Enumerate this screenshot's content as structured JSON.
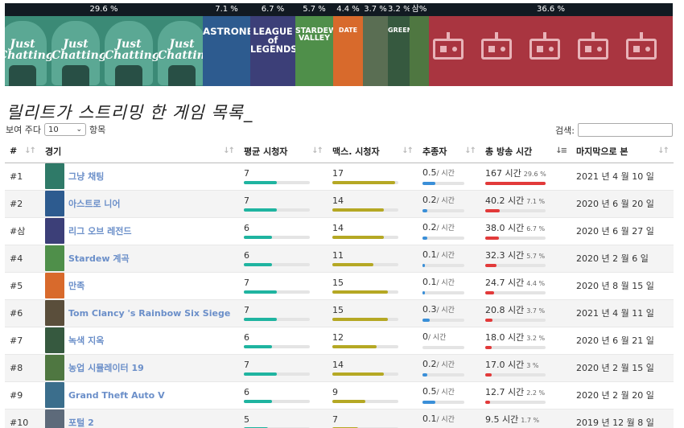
{
  "strip": [
    {
      "pct": "29.6 %",
      "width": 29.6,
      "kind": "jc",
      "name": "Just Chatting"
    },
    {
      "pct": "7.1 %",
      "width": 7.1,
      "kind": "astroneer",
      "name": "ASTRONEER",
      "color": "#2d5b8f"
    },
    {
      "pct": "6.7 %",
      "width": 6.7,
      "kind": "league",
      "name": "LEAGUE of LEGENDS",
      "color": "#3c3f78"
    },
    {
      "pct": "5.7 %",
      "width": 5.7,
      "kind": "stardew",
      "name": "STARDEW VALLEY",
      "color": "#4f8f4a"
    },
    {
      "pct": "4.4 %",
      "width": 4.4,
      "kind": "update",
      "name": "DATE",
      "color": "#d86a2c"
    },
    {
      "pct": "3.7 %",
      "width": 3.7,
      "kind": "r6",
      "name": "",
      "color": "#5a6e53"
    },
    {
      "pct": "3.2 %",
      "width": 3.2,
      "kind": "green",
      "name": "GREEN",
      "color": "#36593f"
    },
    {
      "pct": "삼%",
      "width": 2.9,
      "kind": "farm",
      "name": "",
      "color": "#4f7741"
    },
    {
      "pct": "36.6 %",
      "width": 36.6,
      "kind": "other",
      "name": ""
    }
  ],
  "title": "릴리트가 스트리밍 한 게임 목록_",
  "controls": {
    "show_label": "보여 주다",
    "page_size": "10",
    "entries_label": "항목",
    "search_label": "검색:",
    "search_value": ""
  },
  "columns": [
    "#",
    "경기",
    "평균 시청자",
    "맥스. 시청자",
    "추종자",
    "총 방송 시간",
    "마지막으로 본"
  ],
  "per_hour": "/ 시간",
  "hours_label": "시간",
  "rows": [
    {
      "rank": "#1",
      "game": "그냥 채팅",
      "thumb": "#2f7a68",
      "avg": "7",
      "avg_frac": 0.5,
      "max": "17",
      "max_frac": 0.95,
      "fol": "0.5",
      "fol_frac": 0.3,
      "hours": "167",
      "hours_pct": "29.6 %",
      "hours_frac": 1.0,
      "last": "2021 년 4 월 10 일"
    },
    {
      "rank": "#2",
      "game": "아스트로 니어",
      "thumb": "#2d5b8f",
      "avg": "7",
      "avg_frac": 0.5,
      "max": "14",
      "max_frac": 0.78,
      "fol": "0.2",
      "fol_frac": 0.12,
      "hours": "40.2",
      "hours_pct": "7.1 %",
      "hours_frac": 0.24,
      "last": "2020 년 6 월 20 일"
    },
    {
      "rank": "#삼",
      "game": "리그 오브 레전드",
      "thumb": "#3c3f78",
      "avg": "6",
      "avg_frac": 0.43,
      "max": "14",
      "max_frac": 0.78,
      "fol": "0.2",
      "fol_frac": 0.12,
      "hours": "38.0",
      "hours_pct": "6.7 %",
      "hours_frac": 0.23,
      "last": "2020 년 6 월 27 일"
    },
    {
      "rank": "#4",
      "game": "Stardew 계곡",
      "thumb": "#4f8f4a",
      "avg": "6",
      "avg_frac": 0.43,
      "max": "11",
      "max_frac": 0.62,
      "fol": "0.1",
      "fol_frac": 0.06,
      "hours": "32.3",
      "hours_pct": "5.7 %",
      "hours_frac": 0.19,
      "last": "2020 년 2 월 6 일"
    },
    {
      "rank": "#5",
      "game": "만족",
      "thumb": "#d86a2c",
      "avg": "7",
      "avg_frac": 0.5,
      "max": "15",
      "max_frac": 0.84,
      "fol": "0.1",
      "fol_frac": 0.06,
      "hours": "24.7",
      "hours_pct": "4.4 %",
      "hours_frac": 0.15,
      "last": "2020 년 8 월 15 일"
    },
    {
      "rank": "#6",
      "game": "Tom Clancy 's Rainbow Six Siege",
      "thumb": "#5a4e3b",
      "avg": "7",
      "avg_frac": 0.5,
      "max": "15",
      "max_frac": 0.84,
      "fol": "0.3",
      "fol_frac": 0.18,
      "hours": "20.8",
      "hours_pct": "3.7 %",
      "hours_frac": 0.12,
      "last": "2021 년 4 월 11 일"
    },
    {
      "rank": "#7",
      "game": "녹색 지옥",
      "thumb": "#36593f",
      "avg": "6",
      "avg_frac": 0.43,
      "max": "12",
      "max_frac": 0.67,
      "fol": "0",
      "fol_frac": 0,
      "hours": "18.0",
      "hours_pct": "3.2 %",
      "hours_frac": 0.11,
      "last": "2020 년 6 월 21 일"
    },
    {
      "rank": "#8",
      "game": "농업 시뮬레이터 19",
      "thumb": "#4f7741",
      "avg": "7",
      "avg_frac": 0.5,
      "max": "14",
      "max_frac": 0.78,
      "fol": "0.2",
      "fol_frac": 0.12,
      "hours": "17.0",
      "hours_pct": "3 %",
      "hours_frac": 0.1,
      "last": "2020 년 2 월 15 일"
    },
    {
      "rank": "#9",
      "game": "Grand Theft Auto V",
      "thumb": "#3b6e8c",
      "avg": "6",
      "avg_frac": 0.43,
      "max": "9",
      "max_frac": 0.5,
      "fol": "0.5",
      "fol_frac": 0.3,
      "hours": "12.7",
      "hours_pct": "2.2 %",
      "hours_frac": 0.08,
      "last": "2020 년 2 월 20 일"
    },
    {
      "rank": "#10",
      "game": "포털 2",
      "thumb": "#5d6a7a",
      "avg": "5",
      "avg_frac": 0.36,
      "max": "7",
      "max_frac": 0.39,
      "fol": "0.1",
      "fol_frac": 0.06,
      "hours": "9.5",
      "hours_pct": "1.7 %",
      "hours_frac": 0.06,
      "last": "2019 년 12 월 8 일"
    }
  ]
}
